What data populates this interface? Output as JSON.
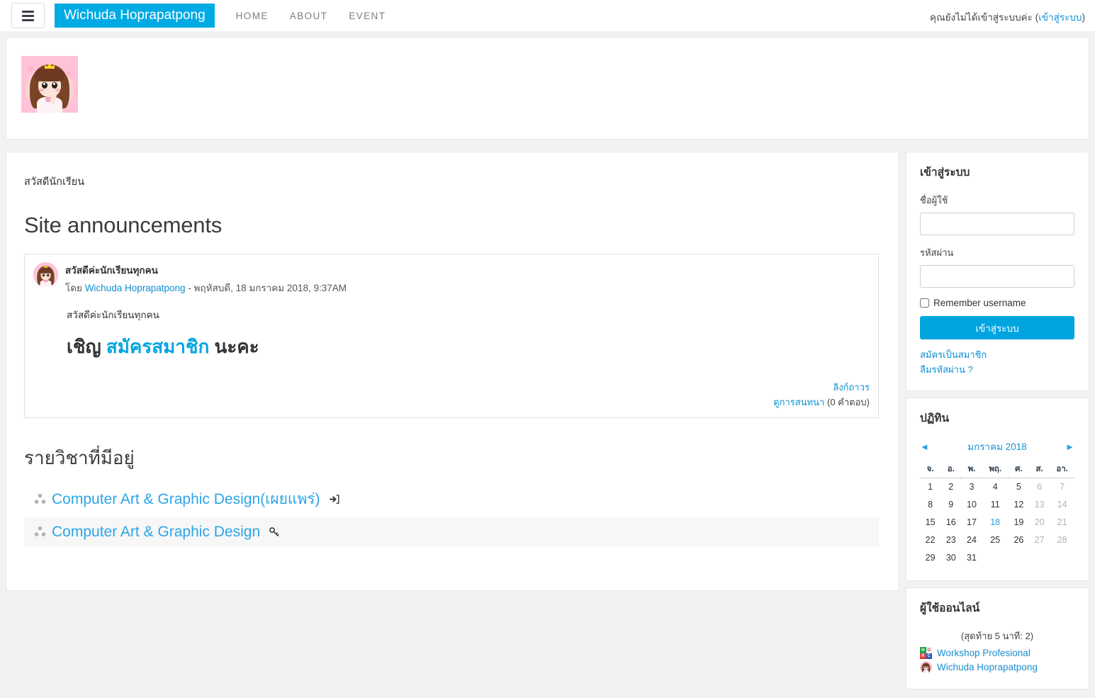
{
  "navbar": {
    "menu_icon": "hamburger-icon",
    "brand": "Wichuda Hoprapatpong",
    "links": [
      {
        "label": "HOME"
      },
      {
        "label": "ABOUT"
      },
      {
        "label": "EVENT"
      }
    ],
    "login_status_text": "คุณยังไม่ได้เข้าสู่ระบบค่ะ (",
    "login_status_link": "เข้าสู่ระบบ",
    "login_status_suffix": ")",
    "brand_color": "#00aae4"
  },
  "main": {
    "greeting": "สวัสดีนักเรียน",
    "section_title": "Site announcements",
    "post": {
      "subject": "สวัสดีค่ะนักเรียนทุกคน",
      "by_prefix": "โดย ",
      "author": "Wichuda Hoprapatpong",
      "date": " - พฤหัสบดี, 18 มกราคม 2018, 9:37AM",
      "body_line1": "สวัสดีค่ะนักเรียนทุกคน",
      "body_big_before": "เชิญ ",
      "body_big_link": "สมัครสมาชิก",
      "body_big_after": " นะคะ",
      "permalink": "ลิงก์ถาวร",
      "discuss_link": "ดูการสนทนา",
      "discuss_count": " (0 คำตอบ)"
    },
    "courses_title": "รายวิชาที่มีอยู่",
    "courses": [
      {
        "name": "Computer Art & Graphic Design(เผยแพร่)",
        "icon": "sign-in-icon",
        "course_icon": "course-share-icon"
      },
      {
        "name": "Computer Art & Graphic Design",
        "icon": "key-icon",
        "course_icon": "course-share-icon"
      }
    ]
  },
  "login_block": {
    "title": "เข้าสู่ระบบ",
    "username_label": "ชื่อผู้ใช้",
    "username_value": "",
    "username_placeholder": "",
    "password_label": "รหัสผ่าน",
    "password_value": "",
    "password_placeholder": "",
    "remember_label": "Remember username",
    "remember_checked": false,
    "submit_label": "เข้าสู่ระบบ",
    "signup_link": "สมัครเป็นสมาชิก",
    "forgot_link": "ลืมรหัสผ่าน ?",
    "button_color": "#00a5e0"
  },
  "calendar_block": {
    "title": "ปฏิทิน",
    "prev_icon": "triangle-left-icon",
    "next_icon": "triangle-right-icon",
    "month": "มกราคม 2018",
    "day_headers": [
      "จ.",
      "อ.",
      "พ.",
      "พฤ.",
      "ศ.",
      "ส.",
      "อา."
    ],
    "weeks": [
      [
        {
          "d": "1"
        },
        {
          "d": "2"
        },
        {
          "d": "3"
        },
        {
          "d": "4"
        },
        {
          "d": "5"
        },
        {
          "d": "6",
          "weekend": true
        },
        {
          "d": "7",
          "weekend": true
        }
      ],
      [
        {
          "d": "8"
        },
        {
          "d": "9"
        },
        {
          "d": "10"
        },
        {
          "d": "11"
        },
        {
          "d": "12"
        },
        {
          "d": "13",
          "weekend": true
        },
        {
          "d": "14",
          "weekend": true
        }
      ],
      [
        {
          "d": "15"
        },
        {
          "d": "16"
        },
        {
          "d": "17"
        },
        {
          "d": "18",
          "today": true
        },
        {
          "d": "19"
        },
        {
          "d": "20",
          "weekend": true
        },
        {
          "d": "21",
          "weekend": true
        }
      ],
      [
        {
          "d": "22"
        },
        {
          "d": "23"
        },
        {
          "d": "24"
        },
        {
          "d": "25"
        },
        {
          "d": "26"
        },
        {
          "d": "27",
          "weekend": true
        },
        {
          "d": "28",
          "weekend": true
        }
      ],
      [
        {
          "d": "29"
        },
        {
          "d": "30"
        },
        {
          "d": "31"
        },
        {
          "d": ""
        },
        {
          "d": ""
        },
        {
          "d": "",
          "weekend": true
        },
        {
          "d": "",
          "weekend": true
        }
      ]
    ],
    "today_color": "#29a3dd"
  },
  "online_block": {
    "title": "ผู้ใช้ออนไลน์",
    "count_text": "(สุดท้าย 5 นาที: 2)",
    "users": [
      {
        "name": "Workshop Profesional",
        "avatar": "logo-avatar"
      },
      {
        "name": "Wichuda Hoprapatpong",
        "avatar": "photo-avatar"
      }
    ]
  }
}
